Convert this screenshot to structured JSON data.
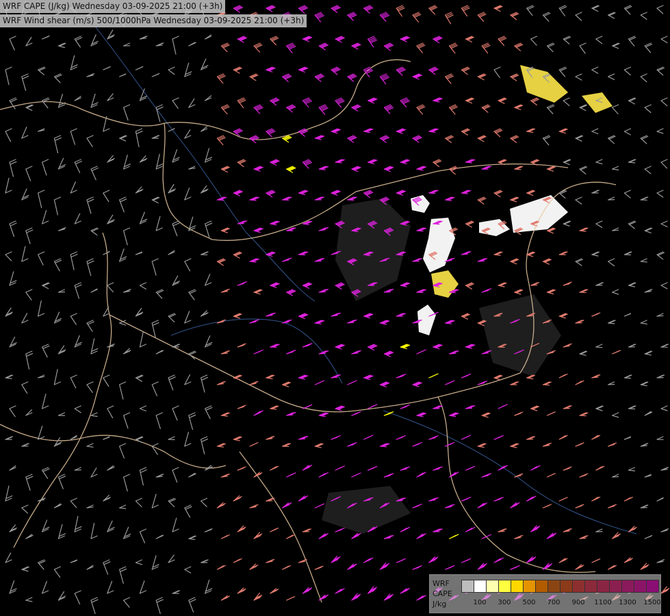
{
  "titles": {
    "line1": "WRF CAPE (J/kg) Wednesday 03-09-2025 21:00 (+3h)",
    "line2": "WRF Wind shear (m/s) 500/1000hPa Wednesday 03-09-2025 21:00 (+3h)"
  },
  "legend": {
    "label_line1": "WRF",
    "label_line2": "CAPE",
    "label_line3": "J/kg",
    "colors": [
      "#bdbdbd",
      "#ffffff",
      "#ffffb0",
      "#ffff40",
      "#ffd700",
      "#e59400",
      "#b25b00",
      "#8b4513",
      "#8b3a1a",
      "#8e2f2f",
      "#8b2a3a",
      "#8b2544",
      "#8b2050",
      "#8b1a5c",
      "#8b1468",
      "#8b0e74"
    ],
    "ticks": [
      "100",
      "300",
      "500",
      "700",
      "900",
      "1100",
      "1300",
      "1500"
    ]
  },
  "colors": {
    "weak_shear": "#9a9a9a",
    "moderate_shear": "#e07a6e",
    "strong_shear": "#dd22dd",
    "very_strong_shear": "#ffff00",
    "border": "#e8c8a0",
    "river": "#3a5f9f"
  }
}
